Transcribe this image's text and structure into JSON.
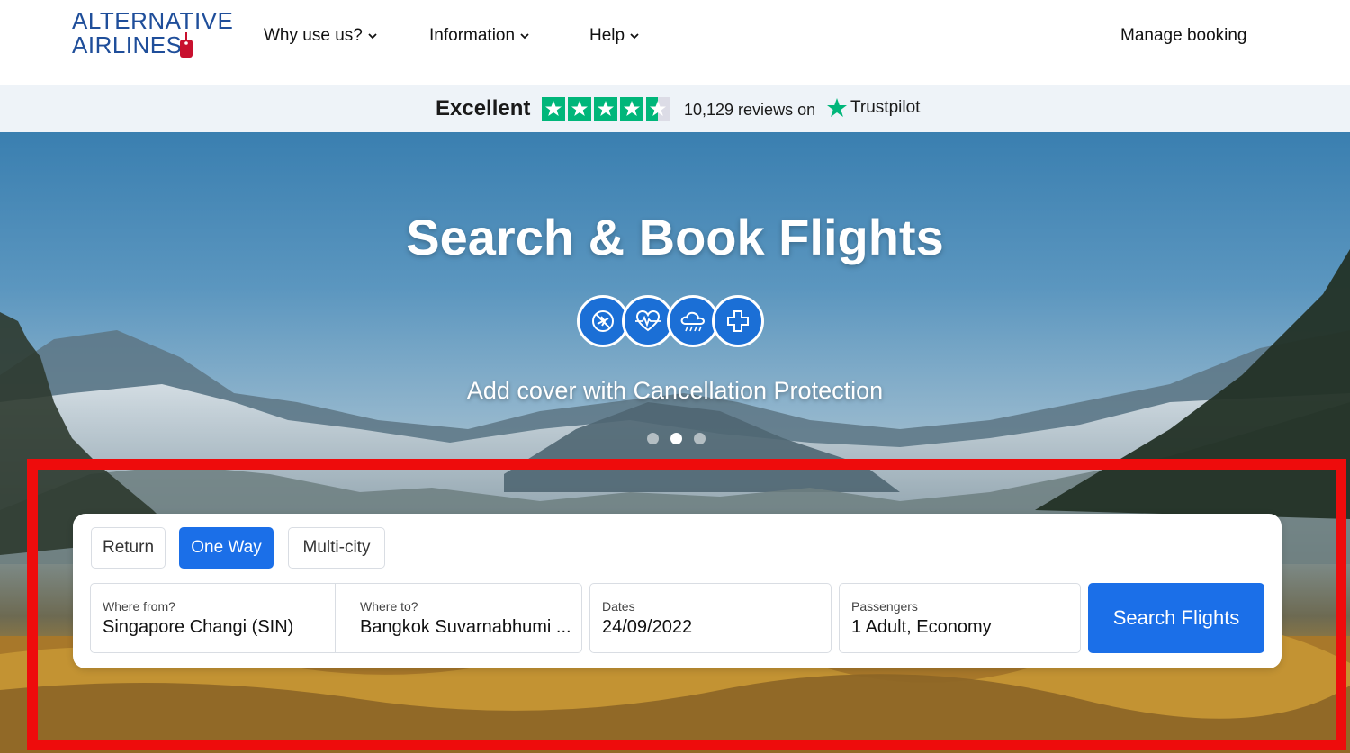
{
  "header": {
    "logo": {
      "line1": "ALTERNATIVE",
      "line2": "AIRLINES"
    },
    "nav": [
      {
        "label": "Why use us?"
      },
      {
        "label": "Information"
      },
      {
        "label": "Help"
      }
    ],
    "manage_booking": "Manage booking"
  },
  "trustpilot": {
    "rating_text": "Excellent",
    "stars": 4.5,
    "reviews_text": "10,129 reviews on",
    "brand": "Trustpilot"
  },
  "hero": {
    "title": "Search & Book Flights",
    "icons": [
      "cancelled-flight-icon",
      "heart-health-icon",
      "weather-cloud-icon",
      "medical-cross-icon"
    ],
    "subtitle": "Add cover with Cancellation Protection",
    "slides": 3,
    "active_slide": 2
  },
  "search": {
    "trip_types": [
      "Return",
      "One Way",
      "Multi-city"
    ],
    "active_trip_type": "One Way",
    "from": {
      "label": "Where from?",
      "value": "Singapore Changi (SIN)"
    },
    "to": {
      "label": "Where to?",
      "value": "Bangkok Suvarnabhumi ..."
    },
    "dates": {
      "label": "Dates",
      "value": "24/09/2022"
    },
    "passengers": {
      "label": "Passengers",
      "value": "1 Adult, Economy"
    },
    "button": "Search Flights"
  },
  "colors": {
    "brand_blue": "#1f4e9a",
    "primary_button": "#1b6fe8",
    "trustpilot_green": "#00b67a",
    "highlight_red": "#ee0c0c"
  }
}
